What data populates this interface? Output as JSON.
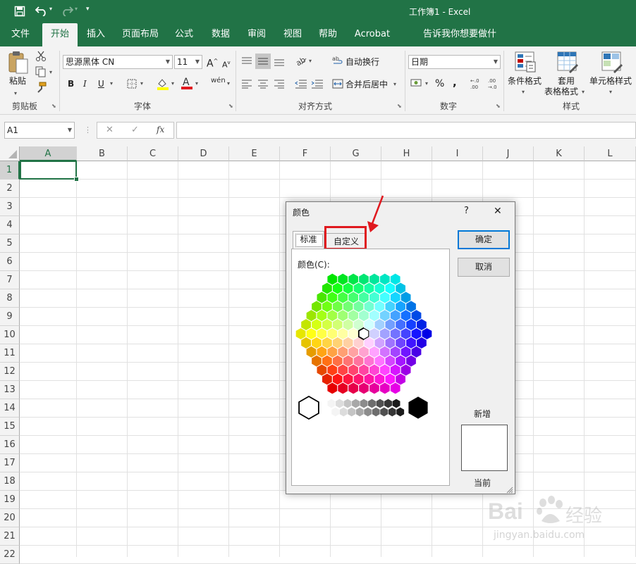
{
  "window": {
    "title": "工作簿1  -  Excel"
  },
  "quick_access": {
    "save": "save-icon",
    "undo": "undo-icon",
    "redo": "redo-icon",
    "customize": "▾"
  },
  "ribbon_tabs": [
    {
      "label": "文件"
    },
    {
      "label": "开始"
    },
    {
      "label": "插入"
    },
    {
      "label": "页面布局"
    },
    {
      "label": "公式"
    },
    {
      "label": "数据"
    },
    {
      "label": "审阅"
    },
    {
      "label": "视图"
    },
    {
      "label": "帮助"
    },
    {
      "label": "Acrobat"
    },
    {
      "label": "告诉我你想要做什么"
    }
  ],
  "ribbon": {
    "clipboard": {
      "paste_label": "粘贴",
      "group_label": "剪贴板"
    },
    "font": {
      "font_name": "思源黑体 CN",
      "font_size": "11",
      "group_label": "字体",
      "bold": "B",
      "italic": "I",
      "underline": "U",
      "grow": "A",
      "shrink": "A",
      "phonetic": "wén"
    },
    "alignment": {
      "wrap_text": "自动换行",
      "merge_center": "合并后居中",
      "group_label": "对齐方式"
    },
    "number": {
      "format": "日期",
      "percent": "%",
      "comma": ",",
      "inc_decimal": ".00→.0",
      "dec_decimal": ".0→.00",
      "group_label": "数字"
    },
    "styles": {
      "conditional": "条件格式",
      "table_format_1": "套用",
      "table_format_2": "表格格式",
      "cell_styles": "单元格样式",
      "group_label": "样式"
    }
  },
  "formula_bar": {
    "name_box": "A1",
    "cancel": "✕",
    "enter": "✓",
    "fx": "fx",
    "formula": ""
  },
  "sheet": {
    "columns": [
      "A",
      "B",
      "C",
      "D",
      "E",
      "F",
      "G",
      "H",
      "I",
      "J",
      "K",
      "L"
    ],
    "rows": [
      "1",
      "2",
      "3",
      "4",
      "5",
      "6",
      "7",
      "8",
      "9",
      "10",
      "11",
      "12",
      "13",
      "14",
      "15",
      "16",
      "17",
      "18",
      "19",
      "20",
      "21",
      "22"
    ],
    "active_cell": "A1"
  },
  "dialog": {
    "title": "颜色",
    "help": "?",
    "close": "✕",
    "tab_standard": "标准",
    "tab_custom": "自定义",
    "colors_label": "颜色(C):",
    "ok": "确定",
    "cancel": "取消",
    "new_label": "新增",
    "current_label": "当前"
  },
  "watermark": {
    "brand": "Bai",
    "brand_cn": "经验",
    "url": "jingyan.baidu.com"
  },
  "colors": {
    "excel_green": "#217346",
    "highlight_red": "#e0191f",
    "default_border": "#0078d7"
  }
}
